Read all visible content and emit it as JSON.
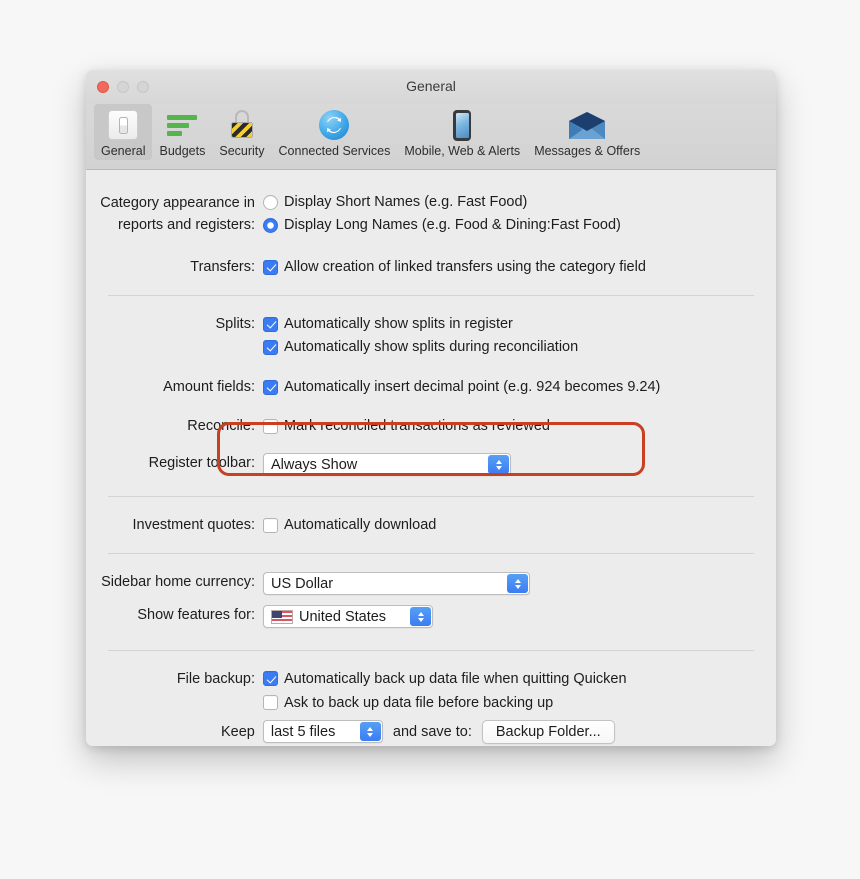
{
  "window": {
    "title": "General",
    "traffic_lights": [
      "close-button",
      "minimize-button",
      "maximize-button"
    ]
  },
  "toolbar": {
    "items": [
      {
        "label": "General",
        "icon": "toggle-switch-icon",
        "selected": true
      },
      {
        "label": "Budgets",
        "icon": "bar-chart-icon",
        "selected": false
      },
      {
        "label": "Security",
        "icon": "padlock-icon",
        "selected": false
      },
      {
        "label": "Connected Services",
        "icon": "sync-arrows-icon",
        "selected": false
      },
      {
        "label": "Mobile, Web & Alerts",
        "icon": "phone-icon",
        "selected": false
      },
      {
        "label": "Messages & Offers",
        "icon": "envelope-icon",
        "selected": false
      }
    ]
  },
  "settings": {
    "category_appearance": {
      "label_line1": "Category appearance in",
      "label_line2": "reports and registers:",
      "options": [
        {
          "text": "Display Short Names (e.g. Fast Food)",
          "selected": false
        },
        {
          "text": "Display Long Names (e.g. Food & Dining:Fast Food)",
          "selected": true
        }
      ]
    },
    "transfers": {
      "label": "Transfers:",
      "checkbox": {
        "text": "Allow creation of linked transfers using the category field",
        "checked": true
      }
    },
    "splits": {
      "label": "Splits:",
      "highlighted": true,
      "highlight_color": "#c8401f",
      "checkboxes": [
        {
          "text": "Automatically show splits in register",
          "checked": true
        },
        {
          "text": "Automatically show splits during reconciliation",
          "checked": true
        }
      ]
    },
    "amount_fields": {
      "label": "Amount fields:",
      "checkbox": {
        "text": "Automatically insert decimal point (e.g. 924 becomes 9.24)",
        "checked": true
      }
    },
    "reconcile": {
      "label": "Reconcile:",
      "checkbox": {
        "text": "Mark reconciled transactions as reviewed",
        "checked": false
      }
    },
    "register_toolbar": {
      "label": "Register toolbar:",
      "value": "Always Show"
    },
    "investment_quotes": {
      "label": "Investment quotes:",
      "checkbox": {
        "text": "Automatically download",
        "checked": false
      }
    },
    "sidebar_home_currency": {
      "label": "Sidebar home currency:",
      "value": "US Dollar"
    },
    "show_features_for": {
      "label": "Show features for:",
      "value": "United States",
      "icon": "us-flag-icon"
    },
    "file_backup": {
      "label": "File backup:",
      "checkboxes": [
        {
          "text": "Automatically back up data file when quitting Quicken",
          "checked": true
        },
        {
          "text": "Ask to back up data file before backing up",
          "checked": false
        }
      ],
      "keep_label": "Keep",
      "keep_value": "last 5 files",
      "save_to_label": "and save to:",
      "folder_button": "Backup Folder..."
    }
  },
  "colors": {
    "accent_blue": "#3b7cf4",
    "highlight_red": "#c8401f",
    "toolbar_bg": "#d6d6d6",
    "content_bg": "#ececec"
  }
}
